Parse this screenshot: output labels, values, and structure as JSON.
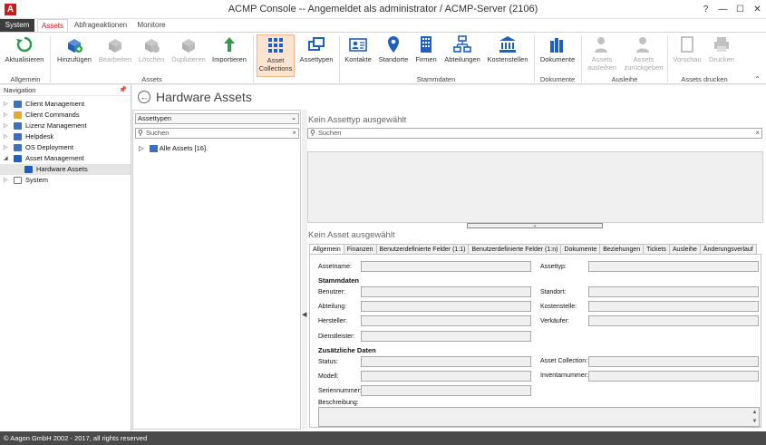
{
  "window": {
    "title": "ACMP Console -- Angemeldet als administrator / ACMP-Server (2106)",
    "logo_letter": "A",
    "controls": {
      "help": "?",
      "minimize": "—",
      "maximize": "☐",
      "close": "✕"
    }
  },
  "ribbon_tabs": [
    "System",
    "Assets",
    "Abfrageaktionen",
    "Monitore"
  ],
  "ribbon": {
    "buttons": [
      {
        "label": "Aktualisieren",
        "icon": "refresh-icon",
        "enabled": true
      },
      {
        "label": "Hinzufügen",
        "icon": "add-asset-icon",
        "enabled": true
      },
      {
        "label": "Bearbeiten",
        "icon": "edit-asset-icon",
        "enabled": false
      },
      {
        "label": "Löschen",
        "icon": "delete-asset-icon",
        "enabled": false
      },
      {
        "label": "Duplizieren",
        "icon": "duplicate-asset-icon",
        "enabled": false
      },
      {
        "label": "Importieren",
        "icon": "import-arrow-icon",
        "enabled": true
      },
      {
        "label": "Asset Collections",
        "icon": "collections-grid-icon",
        "enabled": true,
        "selected": true
      },
      {
        "label": "Assettypen",
        "icon": "assettypes-icon",
        "enabled": true
      },
      {
        "label": "Kontakte",
        "icon": "contact-card-icon",
        "enabled": true
      },
      {
        "label": "Standorte",
        "icon": "location-pin-icon",
        "enabled": true
      },
      {
        "label": "Firmen",
        "icon": "building-icon",
        "enabled": true
      },
      {
        "label": "Abteilungen",
        "icon": "org-chart-icon",
        "enabled": true
      },
      {
        "label": "Kostenstellen",
        "icon": "bank-icon",
        "enabled": true
      },
      {
        "label": "Dokumente",
        "icon": "documents-icon",
        "enabled": true
      },
      {
        "label": "Assets ausleihen",
        "icon": "lend-user-icon",
        "enabled": false
      },
      {
        "label": "Assets zurückgeben",
        "icon": "return-user-icon",
        "enabled": false
      },
      {
        "label": "Vorschau",
        "icon": "preview-icon",
        "enabled": false
      },
      {
        "label": "Drucken",
        "icon": "printer-icon",
        "enabled": false
      }
    ],
    "groups": [
      "Allgemein",
      "Assets",
      "Stammdaten",
      "Dokumente",
      "Ausleihe",
      "Assets drucken"
    ]
  },
  "navigation": {
    "title": "Navigation",
    "items": [
      {
        "label": "Client Management",
        "level": 0,
        "expandable": true
      },
      {
        "label": "Client Commands",
        "level": 0,
        "expandable": true
      },
      {
        "label": "Lizenz Management",
        "level": 0,
        "expandable": true
      },
      {
        "label": "Helpdesk",
        "level": 0,
        "expandable": true
      },
      {
        "label": "OS Deployment",
        "level": 0,
        "expandable": true
      },
      {
        "label": "Asset Management",
        "level": 0,
        "expandable": true,
        "expanded": true
      },
      {
        "label": "Hardware Assets",
        "level": 1,
        "selected": true
      },
      {
        "label": "System",
        "level": 0,
        "expandable": true
      }
    ]
  },
  "main": {
    "page_title": "Hardware Assets",
    "assettype_combo": "Assettypen",
    "left_search_placeholder": "Suchen",
    "tree_root": "Alle Assets [16].",
    "no_assettype": "Kein Assettyp ausgewählt",
    "right_search_placeholder": "Suchen",
    "no_asset": "Kein Asset ausgewählt",
    "detail_tabs": [
      "Allgemein",
      "Finanzen",
      "Benutzerdefinierte Felder (1:1)",
      "Benutzerdefinierte Felder (1:n)",
      "Dokumente",
      "Beziehungen",
      "Tickets",
      "Ausleihe",
      "Änderungsverlauf"
    ],
    "form": {
      "assetname": "Assetname:",
      "assettyp": "Assettyp:",
      "stammdaten": "Stammdaten",
      "benutzer": "Benutzer:",
      "standort": "Standort:",
      "abteilung": "Abteilung:",
      "kostenstelle": "Kostenstelle:",
      "hersteller": "Hersteller:",
      "verkaeufer": "Verkäufer:",
      "dienstleister": "Dienstleister:",
      "zusaetzliche": "Zusätzliche Daten",
      "status": "Status:",
      "asset_collection": "Asset Collection:",
      "modell": "Modell:",
      "inventarnummer": "Inventarnummer:",
      "seriennummer": "Seriennummer:",
      "beschreibung": "Beschreibung:"
    }
  },
  "statusbar": {
    "text": "© Aagon GmbH 2002 - 2017, all rights reserved"
  },
  "colors": {
    "accent": "#d0191c",
    "icon_blue": "#1f5fbf",
    "icon_green": "#2e9e4a",
    "status_bar": "#4a4a4a"
  }
}
